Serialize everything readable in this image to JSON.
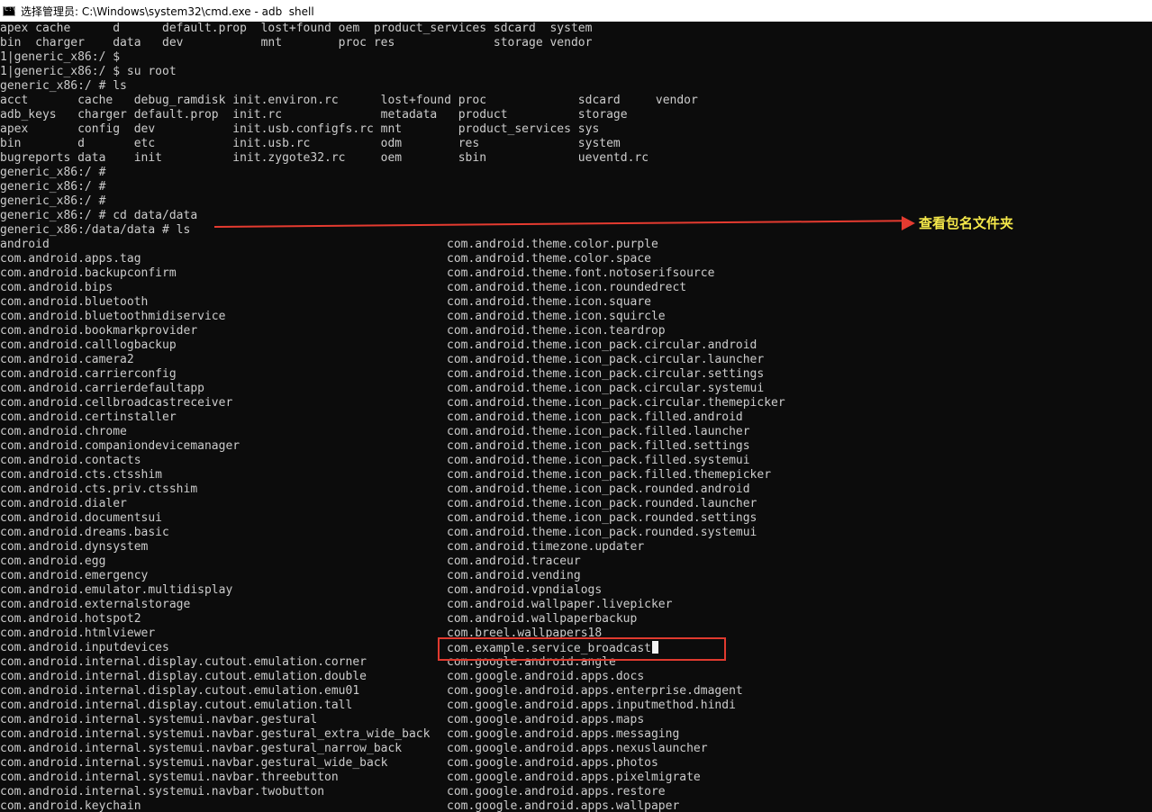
{
  "window": {
    "title": "选择管理员: C:\\Windows\\system32\\cmd.exe - adb  shell",
    "icon_label": "C:\\"
  },
  "terminal": {
    "lines": [
      "apex cache      d      default.prop  lost+found oem  product_services sdcard  system",
      "bin  charger    data   dev           mnt        proc res              storage vendor",
      "1|generic_x86:/ $",
      "1|generic_x86:/ $ su root",
      "generic_x86:/ # ls",
      "acct       cache   debug_ramdisk init.environ.rc      lost+found proc             sdcard     vendor",
      "adb_keys   charger default.prop  init.rc              metadata   product          storage",
      "apex       config  dev           init.usb.configfs.rc mnt        product_services sys",
      "bin        d       etc           init.usb.rc          odm        res              system",
      "bugreports data    init          init.zygote32.rc     oem        sbin             ueventd.rc",
      "generic_x86:/ #",
      "generic_x86:/ #",
      "generic_x86:/ #",
      "generic_x86:/ # cd data/data",
      "generic_x86:/data/data # ls"
    ],
    "packages_left": [
      "android",
      "com.android.apps.tag",
      "com.android.backupconfirm",
      "com.android.bips",
      "com.android.bluetooth",
      "com.android.bluetoothmidiservice",
      "com.android.bookmarkprovider",
      "com.android.calllogbackup",
      "com.android.camera2",
      "com.android.carrierconfig",
      "com.android.carrierdefaultapp",
      "com.android.cellbroadcastreceiver",
      "com.android.certinstaller",
      "com.android.chrome",
      "com.android.companiondevicemanager",
      "com.android.contacts",
      "com.android.cts.ctsshim",
      "com.android.cts.priv.ctsshim",
      "com.android.dialer",
      "com.android.documentsui",
      "com.android.dreams.basic",
      "com.android.dynsystem",
      "com.android.egg",
      "com.android.emergency",
      "com.android.emulator.multidisplay",
      "com.android.externalstorage",
      "com.android.hotspot2",
      "com.android.htmlviewer",
      "com.android.inputdevices",
      "com.android.internal.display.cutout.emulation.corner",
      "com.android.internal.display.cutout.emulation.double",
      "com.android.internal.display.cutout.emulation.emu01",
      "com.android.internal.display.cutout.emulation.tall",
      "com.android.internal.systemui.navbar.gestural",
      "com.android.internal.systemui.navbar.gestural_extra_wide_back",
      "com.android.internal.systemui.navbar.gestural_narrow_back",
      "com.android.internal.systemui.navbar.gestural_wide_back",
      "com.android.internal.systemui.navbar.threebutton",
      "com.android.internal.systemui.navbar.twobutton",
      "com.android.keychain"
    ],
    "packages_right": [
      "com.android.theme.color.purple",
      "com.android.theme.color.space",
      "com.android.theme.font.notoserifsource",
      "com.android.theme.icon.roundedrect",
      "com.android.theme.icon.square",
      "com.android.theme.icon.squircle",
      "com.android.theme.icon.teardrop",
      "com.android.theme.icon_pack.circular.android",
      "com.android.theme.icon_pack.circular.launcher",
      "com.android.theme.icon_pack.circular.settings",
      "com.android.theme.icon_pack.circular.systemui",
      "com.android.theme.icon_pack.circular.themepicker",
      "com.android.theme.icon_pack.filled.android",
      "com.android.theme.icon_pack.filled.launcher",
      "com.android.theme.icon_pack.filled.settings",
      "com.android.theme.icon_pack.filled.systemui",
      "com.android.theme.icon_pack.filled.themepicker",
      "com.android.theme.icon_pack.rounded.android",
      "com.android.theme.icon_pack.rounded.launcher",
      "com.android.theme.icon_pack.rounded.settings",
      "com.android.theme.icon_pack.rounded.systemui",
      "com.android.timezone.updater",
      "com.android.traceur",
      "com.android.vending",
      "com.android.vpndialogs",
      "com.android.wallpaper.livepicker",
      "com.android.wallpaperbackup",
      "com.breel.wallpapers18",
      "com.example.service_broadcast",
      "com.google.android.angle",
      "com.google.android.apps.docs",
      "com.google.android.apps.enterprise.dmagent",
      "com.google.android.apps.inputmethod.hindi",
      "com.google.android.apps.maps",
      "com.google.android.apps.messaging",
      "com.google.android.apps.nexuslauncher",
      "com.google.android.apps.photos",
      "com.google.android.apps.pixelmigrate",
      "com.google.android.apps.restore",
      "com.google.android.apps.wallpaper"
    ]
  },
  "annotation": {
    "label": "查看包名文件夹",
    "arrow_color": "#e53b30",
    "box_color": "#e03a2f",
    "text_color": "#f5e84a"
  },
  "colors": {
    "background": "#0c0c0c",
    "text": "#cccccc"
  }
}
